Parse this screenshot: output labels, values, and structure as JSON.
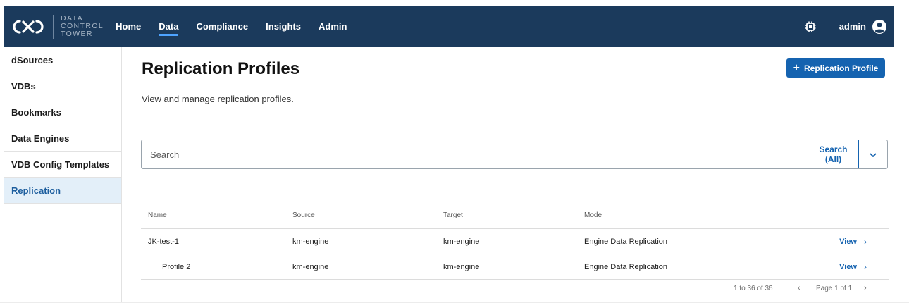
{
  "header": {
    "brand_line1": "DATA",
    "brand_line2": "CONTROL",
    "brand_line3": "TOWER",
    "nav": [
      {
        "label": "Home",
        "active": false
      },
      {
        "label": "Data",
        "active": true
      },
      {
        "label": "Compliance",
        "active": false
      },
      {
        "label": "Insights",
        "active": false
      },
      {
        "label": "Admin",
        "active": false
      }
    ],
    "user_name": "admin",
    "bg_color": "#1b3a5c",
    "icons": [
      "logo-icon",
      "chip-icon",
      "user-icon"
    ]
  },
  "sidebar": {
    "items": [
      {
        "label": "dSources",
        "active": false
      },
      {
        "label": "VDBs",
        "active": false
      },
      {
        "label": "Bookmarks",
        "active": false
      },
      {
        "label": "Data Engines",
        "active": false
      },
      {
        "label": "VDB Config Templates",
        "active": false
      },
      {
        "label": "Replication",
        "active": true
      }
    ]
  },
  "main": {
    "title": "Replication Profiles",
    "description": "View and manage replication profiles.",
    "add_button_label": "Replication Profile",
    "accent_color": "#1563b0",
    "search": {
      "placeholder": "Search",
      "value": "",
      "button_line1": "Search",
      "button_line2": "(All)"
    },
    "table": {
      "columns": [
        "Name",
        "Source",
        "Target",
        "Mode"
      ],
      "rows": [
        {
          "name": "JK-test-1",
          "source": "km-engine",
          "target": "km-engine",
          "mode": "Engine Data Replication",
          "action": "View"
        },
        {
          "name": "Profile 2",
          "source": "km-engine",
          "target": "km-engine",
          "mode": "Engine Data Replication",
          "action": "View"
        }
      ]
    },
    "pagination": {
      "count_text": "1 to 36 of 36",
      "page_text": "Page 1 of 1"
    }
  }
}
